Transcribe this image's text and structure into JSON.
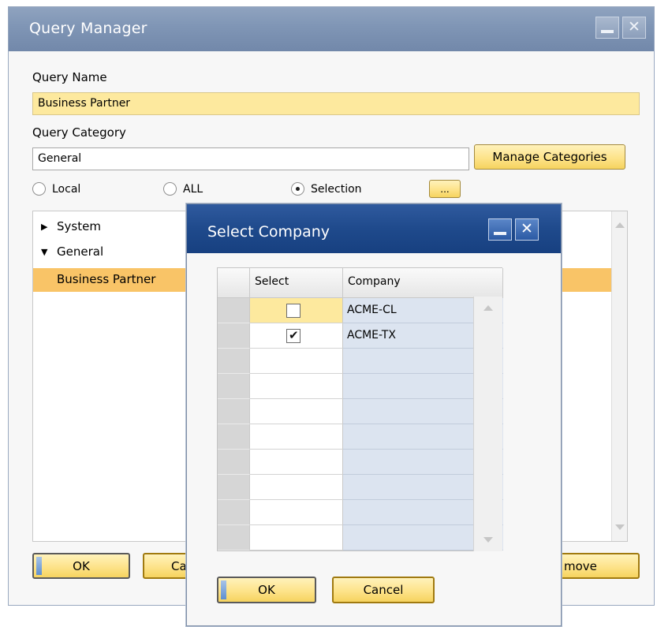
{
  "main": {
    "title": "Query Manager",
    "query_name_label": "Query Name",
    "query_name_value": "Business Partner",
    "query_category_label": "Query Category",
    "query_category_value": "General",
    "manage_categories_label": "Manage Categories",
    "radio_local": "Local",
    "radio_all": "ALL",
    "radio_selection": "Selection",
    "selected_radio": "Selection",
    "ellipsis_label": "...",
    "tree": [
      {
        "label": "System",
        "expanded": false
      },
      {
        "label": "General",
        "expanded": true
      },
      {
        "label": "Business Partner",
        "selected": true
      }
    ],
    "ok_label": "OK",
    "cancel_partial_label": "Ca",
    "remove_partial_label": "move"
  },
  "dialog": {
    "title": "Select Company",
    "col_select": "Select",
    "col_company": "Company",
    "rows": [
      {
        "company": "ACME-CL",
        "checked": false
      },
      {
        "company": "ACME-TX",
        "checked": true
      }
    ],
    "ok_label": "OK",
    "cancel_label": "Cancel"
  },
  "colors": {
    "main_titlebar": "#7f95b5",
    "dialog_titlebar": "#1f4a8c",
    "highlight": "#fde99e",
    "selection": "#f9c467"
  }
}
